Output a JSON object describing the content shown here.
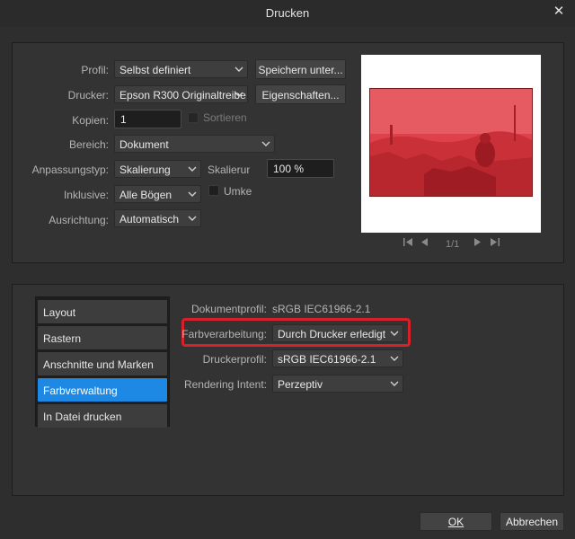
{
  "window": {
    "title": "Drucken"
  },
  "settings": {
    "profile_label": "Profil:",
    "profile_value": "Selbst definiert",
    "save_button": "Speichern unter...",
    "printer_label": "Drucker:",
    "printer_value": "Epson R300 Originaltreibe",
    "properties_button": "Eigenschaften...",
    "copies_label": "Kopien:",
    "copies_value": "1",
    "collate_label": "Sortieren",
    "range_label": "Bereich:",
    "range_value": "Dokument",
    "fit_label": "Anpassungstyp:",
    "fit_value": "Skalierung",
    "scale_label": "Skalierung",
    "scale_value": "100 %",
    "include_label": "Inklusive:",
    "include_value": "Alle Bögen",
    "reverse_label": "Umke",
    "orientation_label": "Ausrichtung:",
    "orientation_value": "Automatisch"
  },
  "preview": {
    "page_indicator": "1/1"
  },
  "nav": {
    "items": [
      {
        "label": "Layout",
        "active": false
      },
      {
        "label": "Rastern",
        "active": false
      },
      {
        "label": "Anschnitte und Marken",
        "active": false
      },
      {
        "label": "Farbverwaltung",
        "active": true
      },
      {
        "label": "In Datei drucken",
        "active": false
      }
    ]
  },
  "color": {
    "doc_profile_label": "Dokumentprofil:",
    "doc_profile_value": "sRGB IEC61966-2.1",
    "handling_label": "Farbverarbeitung:",
    "handling_value": "Durch Drucker erledigt",
    "printer_profile_label": "Druckerprofil:",
    "printer_profile_value": "sRGB IEC61966-2.1",
    "intent_label": "Rendering Intent:",
    "intent_value": "Perzeptiv"
  },
  "footer": {
    "ok_label": "OK",
    "cancel_label": "Abbrechen"
  },
  "colors": {
    "accent": "#1e88e5",
    "highlight": "#d6202a",
    "overlay": "#e03c46"
  }
}
